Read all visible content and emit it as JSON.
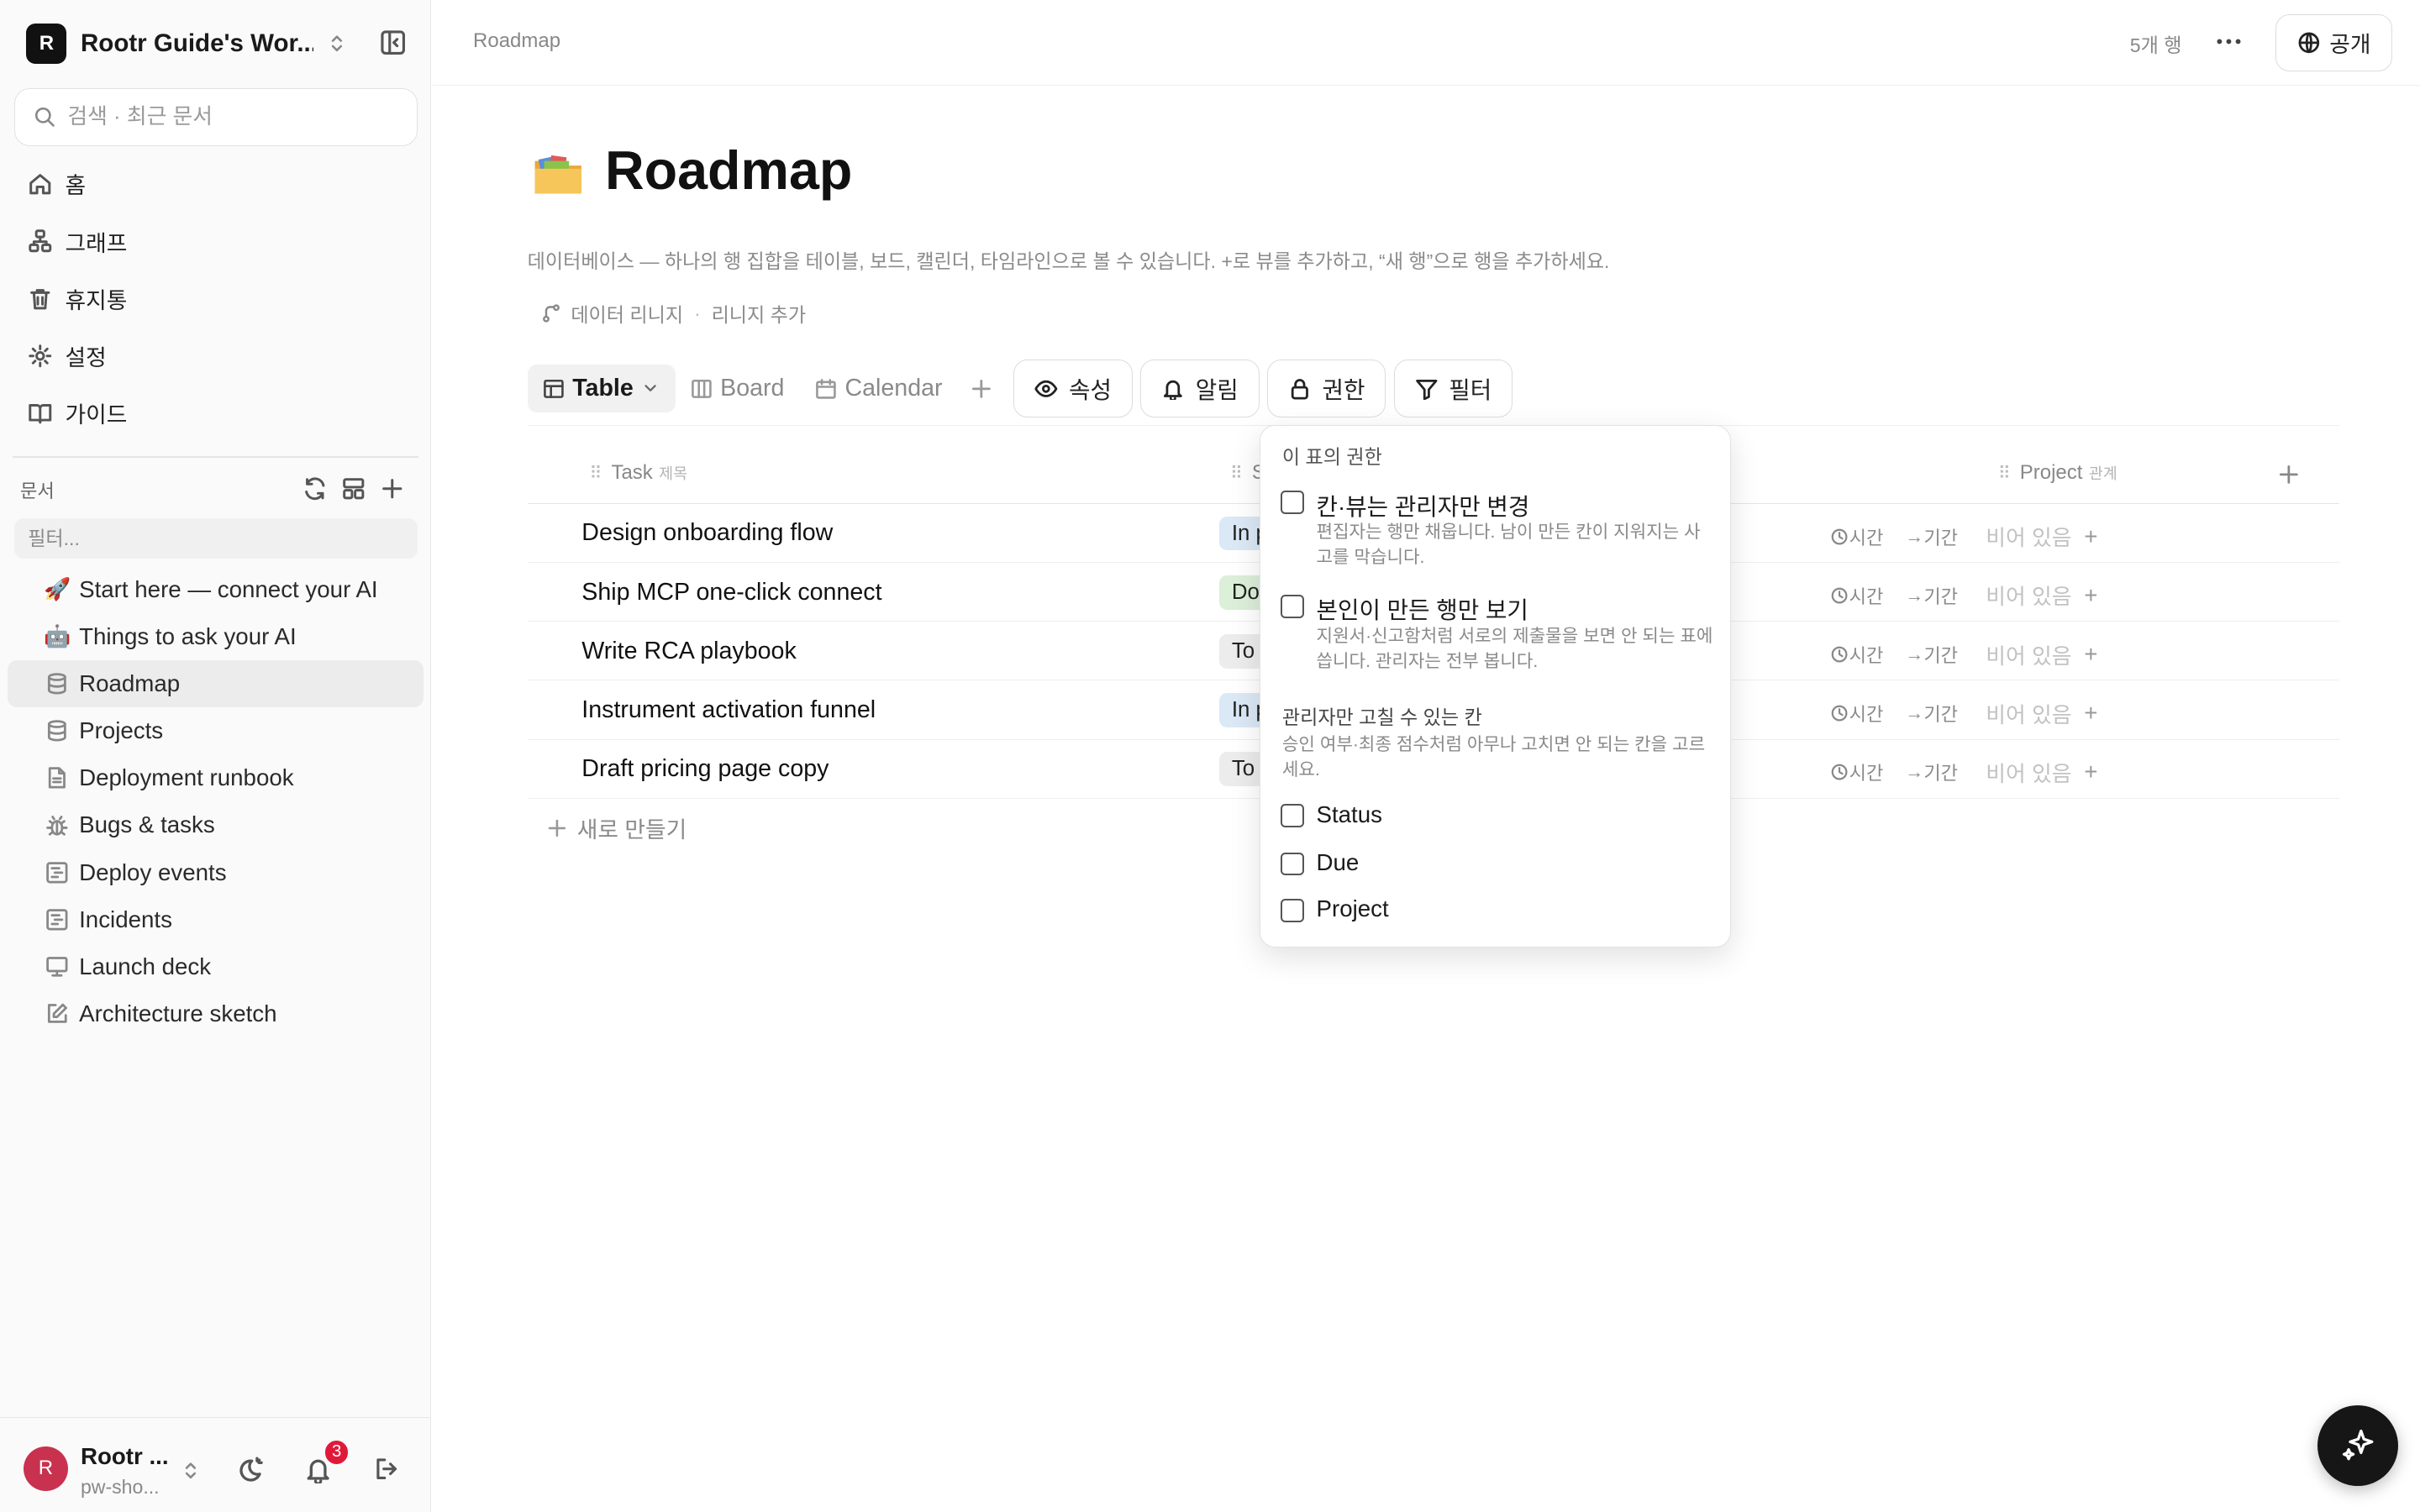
{
  "workspace": {
    "logo_letter": "R",
    "name": "Rootr Guide's Wor..."
  },
  "search": {
    "placeholder": "검색 · 최근 문서"
  },
  "nav": [
    {
      "label": "홈",
      "icon": "home-icon"
    },
    {
      "label": "그래프",
      "icon": "graph-icon"
    },
    {
      "label": "휴지통",
      "icon": "trash-icon"
    },
    {
      "label": "설정",
      "icon": "gear-icon"
    },
    {
      "label": "가이드",
      "icon": "book-icon"
    }
  ],
  "docs": {
    "heading": "문서",
    "filter_placeholder": "필터...",
    "items": [
      {
        "label": "Start here — connect your AI",
        "icon": "rocket-emoji",
        "glyph": "🚀"
      },
      {
        "label": "Things to ask your AI",
        "icon": "robot-emoji",
        "glyph": "🤖"
      },
      {
        "label": "Roadmap",
        "icon": "database-icon",
        "active": true
      },
      {
        "label": "Projects",
        "icon": "database-icon"
      },
      {
        "label": "Deployment runbook",
        "icon": "document-icon"
      },
      {
        "label": "Bugs & tasks",
        "icon": "bug-icon"
      },
      {
        "label": "Deploy events",
        "icon": "timeline-icon"
      },
      {
        "label": "Incidents",
        "icon": "timeline-icon"
      },
      {
        "label": "Launch deck",
        "icon": "presentation-icon"
      },
      {
        "label": "Architecture sketch",
        "icon": "sketch-icon"
      }
    ]
  },
  "user": {
    "avatar_letter": "R",
    "name": "Rootr ...",
    "sub": "pw-sho...",
    "notification_count": "3"
  },
  "topbar": {
    "breadcrumb": "Roadmap",
    "row_count": "5개 행",
    "share_label": "공개"
  },
  "page": {
    "title": "Roadmap",
    "icon": "folder-emoji",
    "description": "데이터베이스 — 하나의 행 집합을 테이블, 보드, 캘린더, 타임라인으로 볼 수 있습니다. +로 뷰를 추가하고, “새 행”으로 행을 추가하세요.",
    "lineage_label": "데이터 리니지",
    "lineage_add": "리니지 추가"
  },
  "views": [
    {
      "label": "Table",
      "icon": "table-icon",
      "active": true
    },
    {
      "label": "Board",
      "icon": "board-icon"
    },
    {
      "label": "Calendar",
      "icon": "calendar-icon"
    }
  ],
  "toolbar": {
    "properties_label": "속성",
    "alerts_label": "알림",
    "permissions_label": "권한",
    "filter_label": "필터"
  },
  "table": {
    "columns": [
      {
        "label": "Task",
        "sub": "제목"
      },
      {
        "label": "S",
        "sub": ""
      },
      {
        "label": "Project",
        "sub": "관계"
      }
    ],
    "rows": [
      {
        "task": "Design onboarding flow",
        "status": "In p",
        "status_color": "#dbe8f6",
        "time": "시간",
        "period": "기간",
        "project": "비어 있음"
      },
      {
        "task": "Ship MCP one-click connect",
        "status": "Do",
        "status_color": "#dcefd9",
        "time": "시간",
        "period": "기간",
        "project": "비어 있음"
      },
      {
        "task": "Write RCA playbook",
        "status": "To",
        "status_color": "#ececec",
        "time": "시간",
        "period": "기간",
        "project": "비어 있음"
      },
      {
        "task": "Instrument activation funnel",
        "status": "In p",
        "status_color": "#dbe8f6",
        "time": "시간",
        "period": "기간",
        "project": "비어 있음"
      },
      {
        "task": "Draft pricing page copy",
        "status": "To",
        "status_color": "#ececec",
        "time": "시간",
        "period": "기간",
        "project": "비어 있음"
      }
    ],
    "new_row_label": "새로 만들기"
  },
  "popover": {
    "title": "이 표의 권한",
    "options": [
      {
        "title": "칸·뷰는 관리자만 변경",
        "desc": "편집자는 행만 채웁니다. 남이 만든 칸이 지워지는 사고를 막습니다.",
        "checked": false
      },
      {
        "title": "본인이 만든 행만 보기",
        "desc": "지원서·신고함처럼 서로의 제출물을 보면 안 되는 표에 씁니다. 관리자는 전부 봅니다.",
        "checked": false
      }
    ],
    "admin_cols_title": "관리자만 고칠 수 있는 칸",
    "admin_cols_desc": "승인 여부·최종 점수처럼 아무나 고치면 안 되는 칸을 고르세요.",
    "columns": [
      {
        "label": "Status",
        "checked": false
      },
      {
        "label": "Due",
        "checked": false
      },
      {
        "label": "Project",
        "checked": false
      }
    ]
  }
}
